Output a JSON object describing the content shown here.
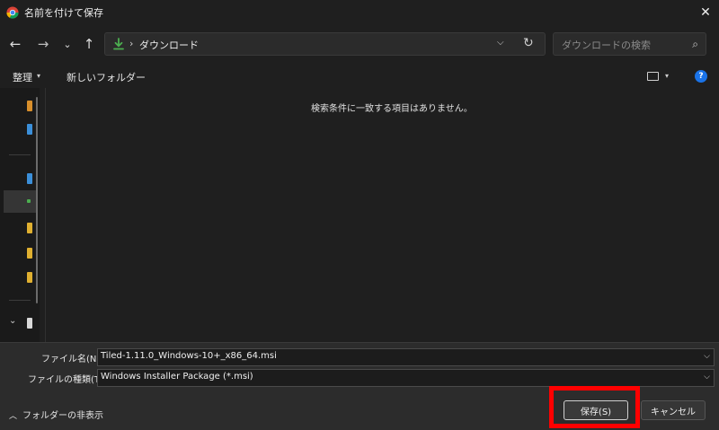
{
  "window": {
    "title": "名前を付けて保存",
    "close_glyph": "✕"
  },
  "nav": {
    "back": "←",
    "forward": "→",
    "recent": "⌄",
    "up": "↑"
  },
  "address": {
    "separator": "›",
    "location": "ダウンロード",
    "dropdown": "⌵",
    "refresh": "↻"
  },
  "search": {
    "placeholder": "ダウンロードの検索",
    "icon": "⌕"
  },
  "toolbar": {
    "organize": "整理",
    "caret": "▾",
    "new_folder": "新しいフォルダー",
    "help": "?"
  },
  "navpane": {
    "expand": "⌄"
  },
  "content": {
    "empty_message": "検索条件に一致する項目はありません。"
  },
  "form": {
    "filename_label": "ファイル名(N):",
    "filename_value": "Tiled-1.11.0_Windows-10+_x86_64.msi",
    "filetype_label": "ファイルの種類(T):",
    "filetype_value": "Windows Installer Package (*.msi)",
    "caret": "⌵"
  },
  "footer": {
    "hide_folders": "フォルダーの非表示",
    "save": "保存(S)",
    "cancel": "キャンセル"
  },
  "colors": {
    "accent_blue": "#1a73e8",
    "download_green": "#4caf50",
    "highlight_red": "#ff0000"
  }
}
